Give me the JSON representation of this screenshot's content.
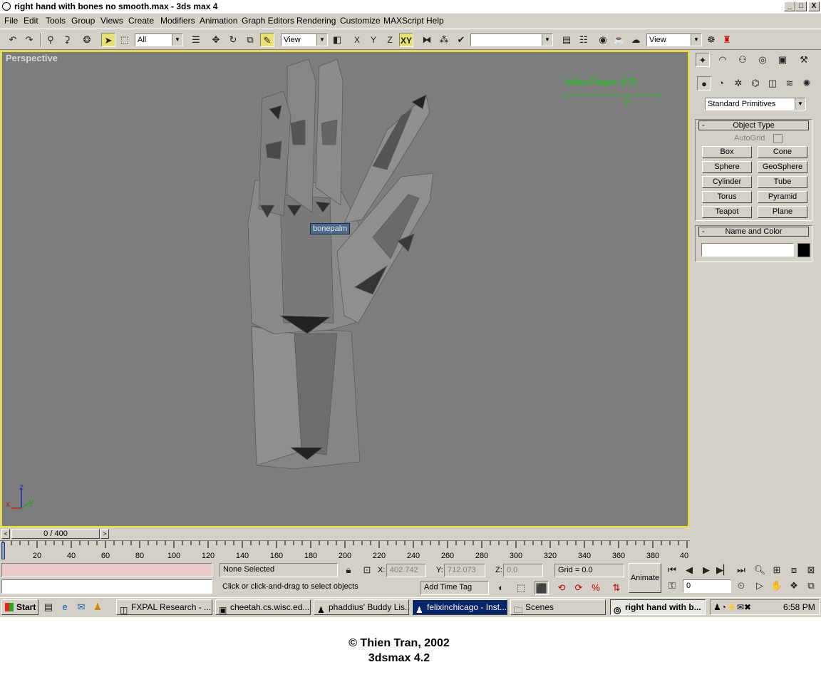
{
  "window": {
    "title": "right hand with bones no smooth.max - 3ds max 4",
    "controls": {
      "minimize": "_",
      "maximize": "□",
      "close": "X"
    }
  },
  "menu": [
    "File",
    "Edit",
    "Tools",
    "Group",
    "Views",
    "Create",
    "Modifiers",
    "Animation",
    "Graph Editors",
    "Rendering",
    "Customize",
    "MAXScript",
    "Help"
  ],
  "toolbar": {
    "filter": "All",
    "ref_coord": "View",
    "axis_x": "X",
    "axis_y": "Y",
    "axis_z": "Z",
    "axis_xy": "XY",
    "named_selection": "",
    "render_type": "View"
  },
  "viewport": {
    "label": "Perspective",
    "ik_readout": "Index Finger: 0.71",
    "bone_tooltip": "bonepalm",
    "axis_labels": {
      "z": "z",
      "x": "x",
      "y": "y"
    }
  },
  "command_panel": {
    "category": "Standard Primitives",
    "object_type": {
      "header": "Object Type",
      "autogrid": "AutoGrid",
      "buttons": [
        "Box",
        "Cone",
        "Sphere",
        "GeoSphere",
        "Cylinder",
        "Tube",
        "Torus",
        "Pyramid",
        "Teapot",
        "Plane"
      ]
    },
    "name_color": {
      "header": "Name and Color",
      "name": "",
      "color": "#000000"
    }
  },
  "timeline": {
    "frame_display": "0 / 400",
    "ticks": [
      "20",
      "40",
      "60",
      "80",
      "100",
      "120",
      "140",
      "160",
      "180",
      "200",
      "220",
      "240",
      "260",
      "280",
      "300",
      "320",
      "340",
      "360",
      "380",
      "40"
    ]
  },
  "status": {
    "selection": "None Selected",
    "prompt": "Click or click-and-drag to select objects",
    "x_label": "X:",
    "x": "402.742",
    "y_label": "Y:",
    "y": "712.073",
    "z_label": "Z:",
    "z": "0.0",
    "grid": "Grid = 0.0",
    "add_time_tag": "Add Time Tag",
    "animate": "Animate",
    "current_frame": "0"
  },
  "taskbar": {
    "start": "Start",
    "tasks": [
      "FXPAL Research - ...",
      "cheetah.cs.wisc.ed...",
      "phaddius' Buddy Lis...",
      "felixinchicago - Inst...",
      "Scenes",
      "right hand with b..."
    ],
    "clock": "6:58 PM"
  },
  "caption": {
    "line1": "© Thien Tran, 2002",
    "line2": "3dsmax 4.2"
  }
}
